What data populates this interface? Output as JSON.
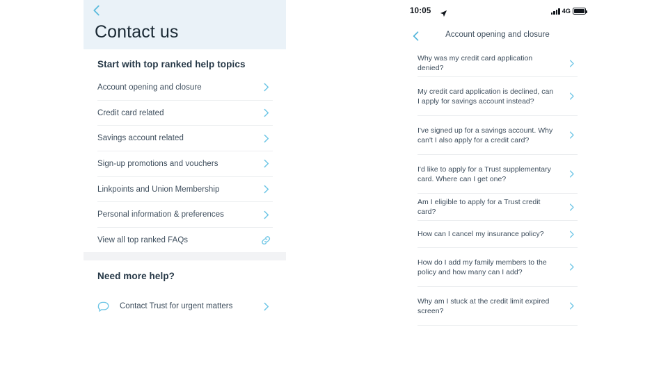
{
  "colors": {
    "header_bg": "#eaf2f8",
    "accent_chevron": "#6ec6e6",
    "accent_chevron_dark": "#3aa9d6",
    "text_primary": "#1b2a35",
    "text_body": "#3d4d5c",
    "divider": "#eceef0",
    "grey_band": "#f2f3f5"
  },
  "left_panel": {
    "back_icon": "chevron-left-icon",
    "title": "Contact us",
    "topics_heading": "Start with top ranked help topics",
    "topics": [
      {
        "label": "Account opening and closure",
        "action_icon": "chevron-right-icon"
      },
      {
        "label": "Credit card related",
        "action_icon": "chevron-right-icon"
      },
      {
        "label": "Savings account related",
        "action_icon": "chevron-right-icon"
      },
      {
        "label": "Sign-up promotions and vouchers",
        "action_icon": "chevron-right-icon"
      },
      {
        "label": "Linkpoints and Union Membership",
        "action_icon": "chevron-right-icon"
      },
      {
        "label": "Personal information & preferences",
        "action_icon": "chevron-right-icon"
      },
      {
        "label": "View all top ranked FAQs",
        "action_icon": "link-chain-icon"
      }
    ],
    "more_help_heading": "Need more help?",
    "contact_row": {
      "icon": "chat-bubble-icon",
      "label": "Contact Trust for urgent matters",
      "action_icon": "chevron-right-icon"
    }
  },
  "right_panel": {
    "status_bar": {
      "time": "10:05",
      "location_icon": "location-arrow-icon",
      "signal_icon": "signal-bars-icon",
      "network": "4G",
      "battery_icon": "battery-full-icon"
    },
    "back_icon": "chevron-left-icon",
    "title": "Account opening and closure",
    "faqs": [
      {
        "text": "Why was my credit card application denied?",
        "lines": 1,
        "action_icon": "chevron-right-icon"
      },
      {
        "text": "My credit card application is declined, can I apply for savings account instead?",
        "lines": 2,
        "action_icon": "chevron-right-icon"
      },
      {
        "text": "I've signed up for a savings account. Why can't I also apply for a credit card?",
        "lines": 2,
        "action_icon": "chevron-right-icon"
      },
      {
        "text": "I'd like to apply for a Trust supplementary card. Where can I get one?",
        "lines": 2,
        "action_icon": "chevron-right-icon"
      },
      {
        "text": "Am I eligible to apply for a Trust credit card?",
        "lines": 1,
        "action_icon": "chevron-right-icon"
      },
      {
        "text": "How can I cancel my insurance policy?",
        "lines": 1,
        "action_icon": "chevron-right-icon"
      },
      {
        "text": "How do I add my family members to the policy and how many can I add?",
        "lines": 2,
        "action_icon": "chevron-right-icon"
      },
      {
        "text": "Why am I stuck at the credit limit expired screen?",
        "lines": 2,
        "action_icon": "chevron-right-icon"
      }
    ]
  }
}
